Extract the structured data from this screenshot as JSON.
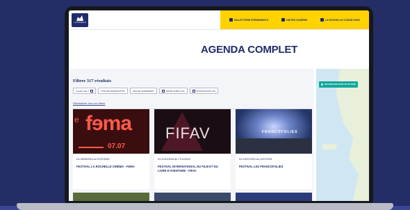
{
  "header": {
    "logo_text": "LA ROCHELLE",
    "links": [
      {
        "label": "BILLETTERIE ÉVÉNEMENTS",
        "icon": "ticket-icon"
      },
      {
        "label": "VISITES GUIDÉES",
        "icon": "guide-icon"
      },
      {
        "label": "LA ROCHELLE OCÉAN PASS",
        "icon": "pass-icon"
      }
    ]
  },
  "page": {
    "title": "AGENDA COMPLET"
  },
  "filters": {
    "results_label": "Filtrer 317 résultats",
    "chips": [
      {
        "label": "À quelle date ?",
        "icon": "calendar-icon"
      },
      {
        "label": "TYPE DE MANIFESTATION",
        "icon": ""
      },
      {
        "label": "LIEU DE L'ÉVÉNEMENT",
        "icon": ""
      },
      {
        "label": "GRAND PUBLIC (32)",
        "icon": "checkbox-icon"
      },
      {
        "label": "POUR ENFANTS (42)",
        "icon": "checkbox-icon"
      }
    ],
    "reset_label": "Réinitialiser tous les filtres"
  },
  "events": [
    {
      "date": "Du 28/06/2024 au 07/07/2024",
      "title": "FESTIVAL LA ROCHELLE CINÉMA - FEMA",
      "image_text": "fɘma",
      "image_small": "e",
      "image_date": "07.07"
    },
    {
      "date": "Du 10/11/2024 au 17/11/2024",
      "title": "FESTIVAL INTERNATIONAL DU FILM ET DU LIVRE D'AVENTURE - FIFAV",
      "image_text": "FIFAV"
    },
    {
      "date": "Du 10/07/2024 au 14/07/2024",
      "title": "FESTIVAL LES FRANCOFOLIES",
      "image_text": "FRANCOFOLIES"
    }
  ],
  "map": {
    "button_label": "RECHERCHER DANS CETTE ZONE"
  }
}
